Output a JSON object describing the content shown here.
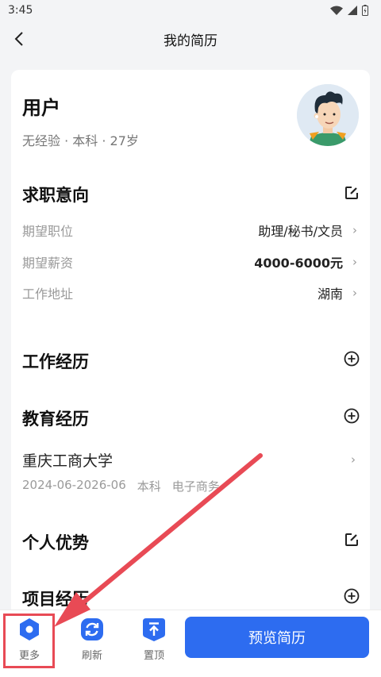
{
  "status_bar": {
    "time": "3:45"
  },
  "nav": {
    "title": "我的简历"
  },
  "profile": {
    "name": "用户",
    "meta": "无经验 · 本科 · 27岁"
  },
  "job_intent": {
    "title": "求职意向",
    "rows": [
      {
        "label": "期望职位",
        "value": "助理/秘书/文员"
      },
      {
        "label": "期望薪资",
        "value": "4000-6000元"
      },
      {
        "label": "工作地址",
        "value": "湖南"
      }
    ]
  },
  "work_experience": {
    "title": "工作经历"
  },
  "education": {
    "title": "教育经历",
    "school": "重庆工商大学",
    "period": "2024-06-2026-06",
    "degree": "本科",
    "major": "电子商务"
  },
  "strengths": {
    "title": "个人优势"
  },
  "projects": {
    "title": "项目经历"
  },
  "bottom_bar": {
    "tabs": [
      {
        "label": "更多"
      },
      {
        "label": "刷新"
      },
      {
        "label": "置顶"
      }
    ],
    "preview_label": "预览简历"
  },
  "colors": {
    "accent": "#2d6cf0",
    "annotation": "#e84a55"
  },
  "icons": [
    "back-icon",
    "wifi-icon",
    "signal-icon",
    "battery-icon",
    "edit-icon",
    "add-circle-icon",
    "more-hexagon-icon",
    "refresh-icon",
    "pin-top-icon"
  ]
}
